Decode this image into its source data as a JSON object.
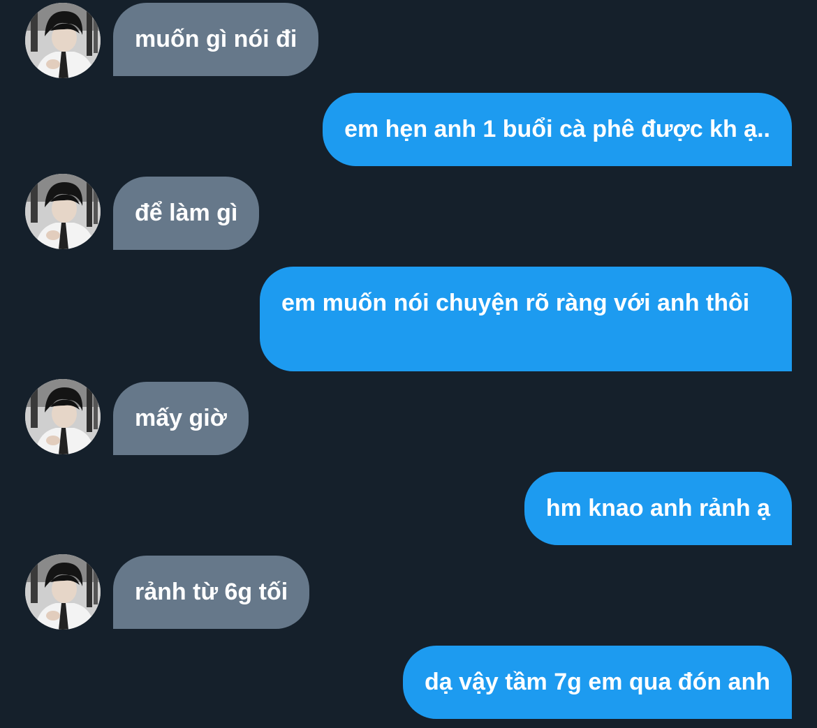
{
  "conversation": {
    "messages": [
      {
        "from": "them",
        "text": "muốn gì nói đi"
      },
      {
        "from": "me",
        "text": "em hẹn anh 1 buổi cà phê được kh ạ.."
      },
      {
        "from": "them",
        "text": "để làm gì"
      },
      {
        "from": "me",
        "text": "em muốn nói chuyện rõ ràng với anh thôi"
      },
      {
        "from": "them",
        "text": "mấy giờ"
      },
      {
        "from": "me",
        "text": "hm knao anh rảnh ạ"
      },
      {
        "from": "them",
        "text": "rảnh từ 6g tối"
      },
      {
        "from": "me",
        "text": "dạ vậy tầm 7g em qua đón anh"
      }
    ]
  },
  "colors": {
    "background": "#15202b",
    "incoming_bubble": "#66788a",
    "outgoing_bubble": "#1d9bf0",
    "text": "#ffffff"
  },
  "icons": {
    "avatar": "contact-photo"
  }
}
